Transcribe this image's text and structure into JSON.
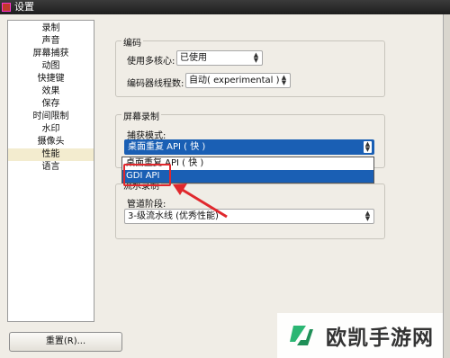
{
  "window": {
    "title": "设置"
  },
  "sidebar": {
    "items": [
      {
        "label": "录制"
      },
      {
        "label": "声音"
      },
      {
        "label": "屏幕捕获"
      },
      {
        "label": "动图"
      },
      {
        "label": "快捷键"
      },
      {
        "label": "效果"
      },
      {
        "label": "保存"
      },
      {
        "label": "时间限制"
      },
      {
        "label": "水印"
      },
      {
        "label": "摄像头"
      },
      {
        "label": "性能",
        "selected": true
      },
      {
        "label": "语言"
      }
    ]
  },
  "encoding": {
    "legend": "编码",
    "multicore_label": "使用多核心:",
    "multicore_value": "已使用",
    "threads_label": "编码器线程数:",
    "threads_value": "自动( experimental )"
  },
  "screen_capture": {
    "legend": "屏幕录制",
    "mode_label": "捕获模式:",
    "mode_value": "桌面重复 API ( 快 )",
    "options": [
      "桌面重复 API ( 快 )",
      "GDI API"
    ],
    "highlighted_option": "GDI API"
  },
  "pipeline": {
    "legend": "流水录制",
    "stage_label": "管道阶段:",
    "stage_value": "3-级流水线 (优秀性能)"
  },
  "footer": {
    "reset_label": "重置(R)..."
  },
  "watermark": {
    "brand": "欧凯手游网"
  },
  "colors": {
    "highlight": "#1a5fb4",
    "annotation": "#e0282d",
    "logo": "#2bb673"
  },
  "icons": [
    "app-icon",
    "chevron-updown-icon",
    "red-arrow-annotation",
    "brand-logo-icon"
  ]
}
